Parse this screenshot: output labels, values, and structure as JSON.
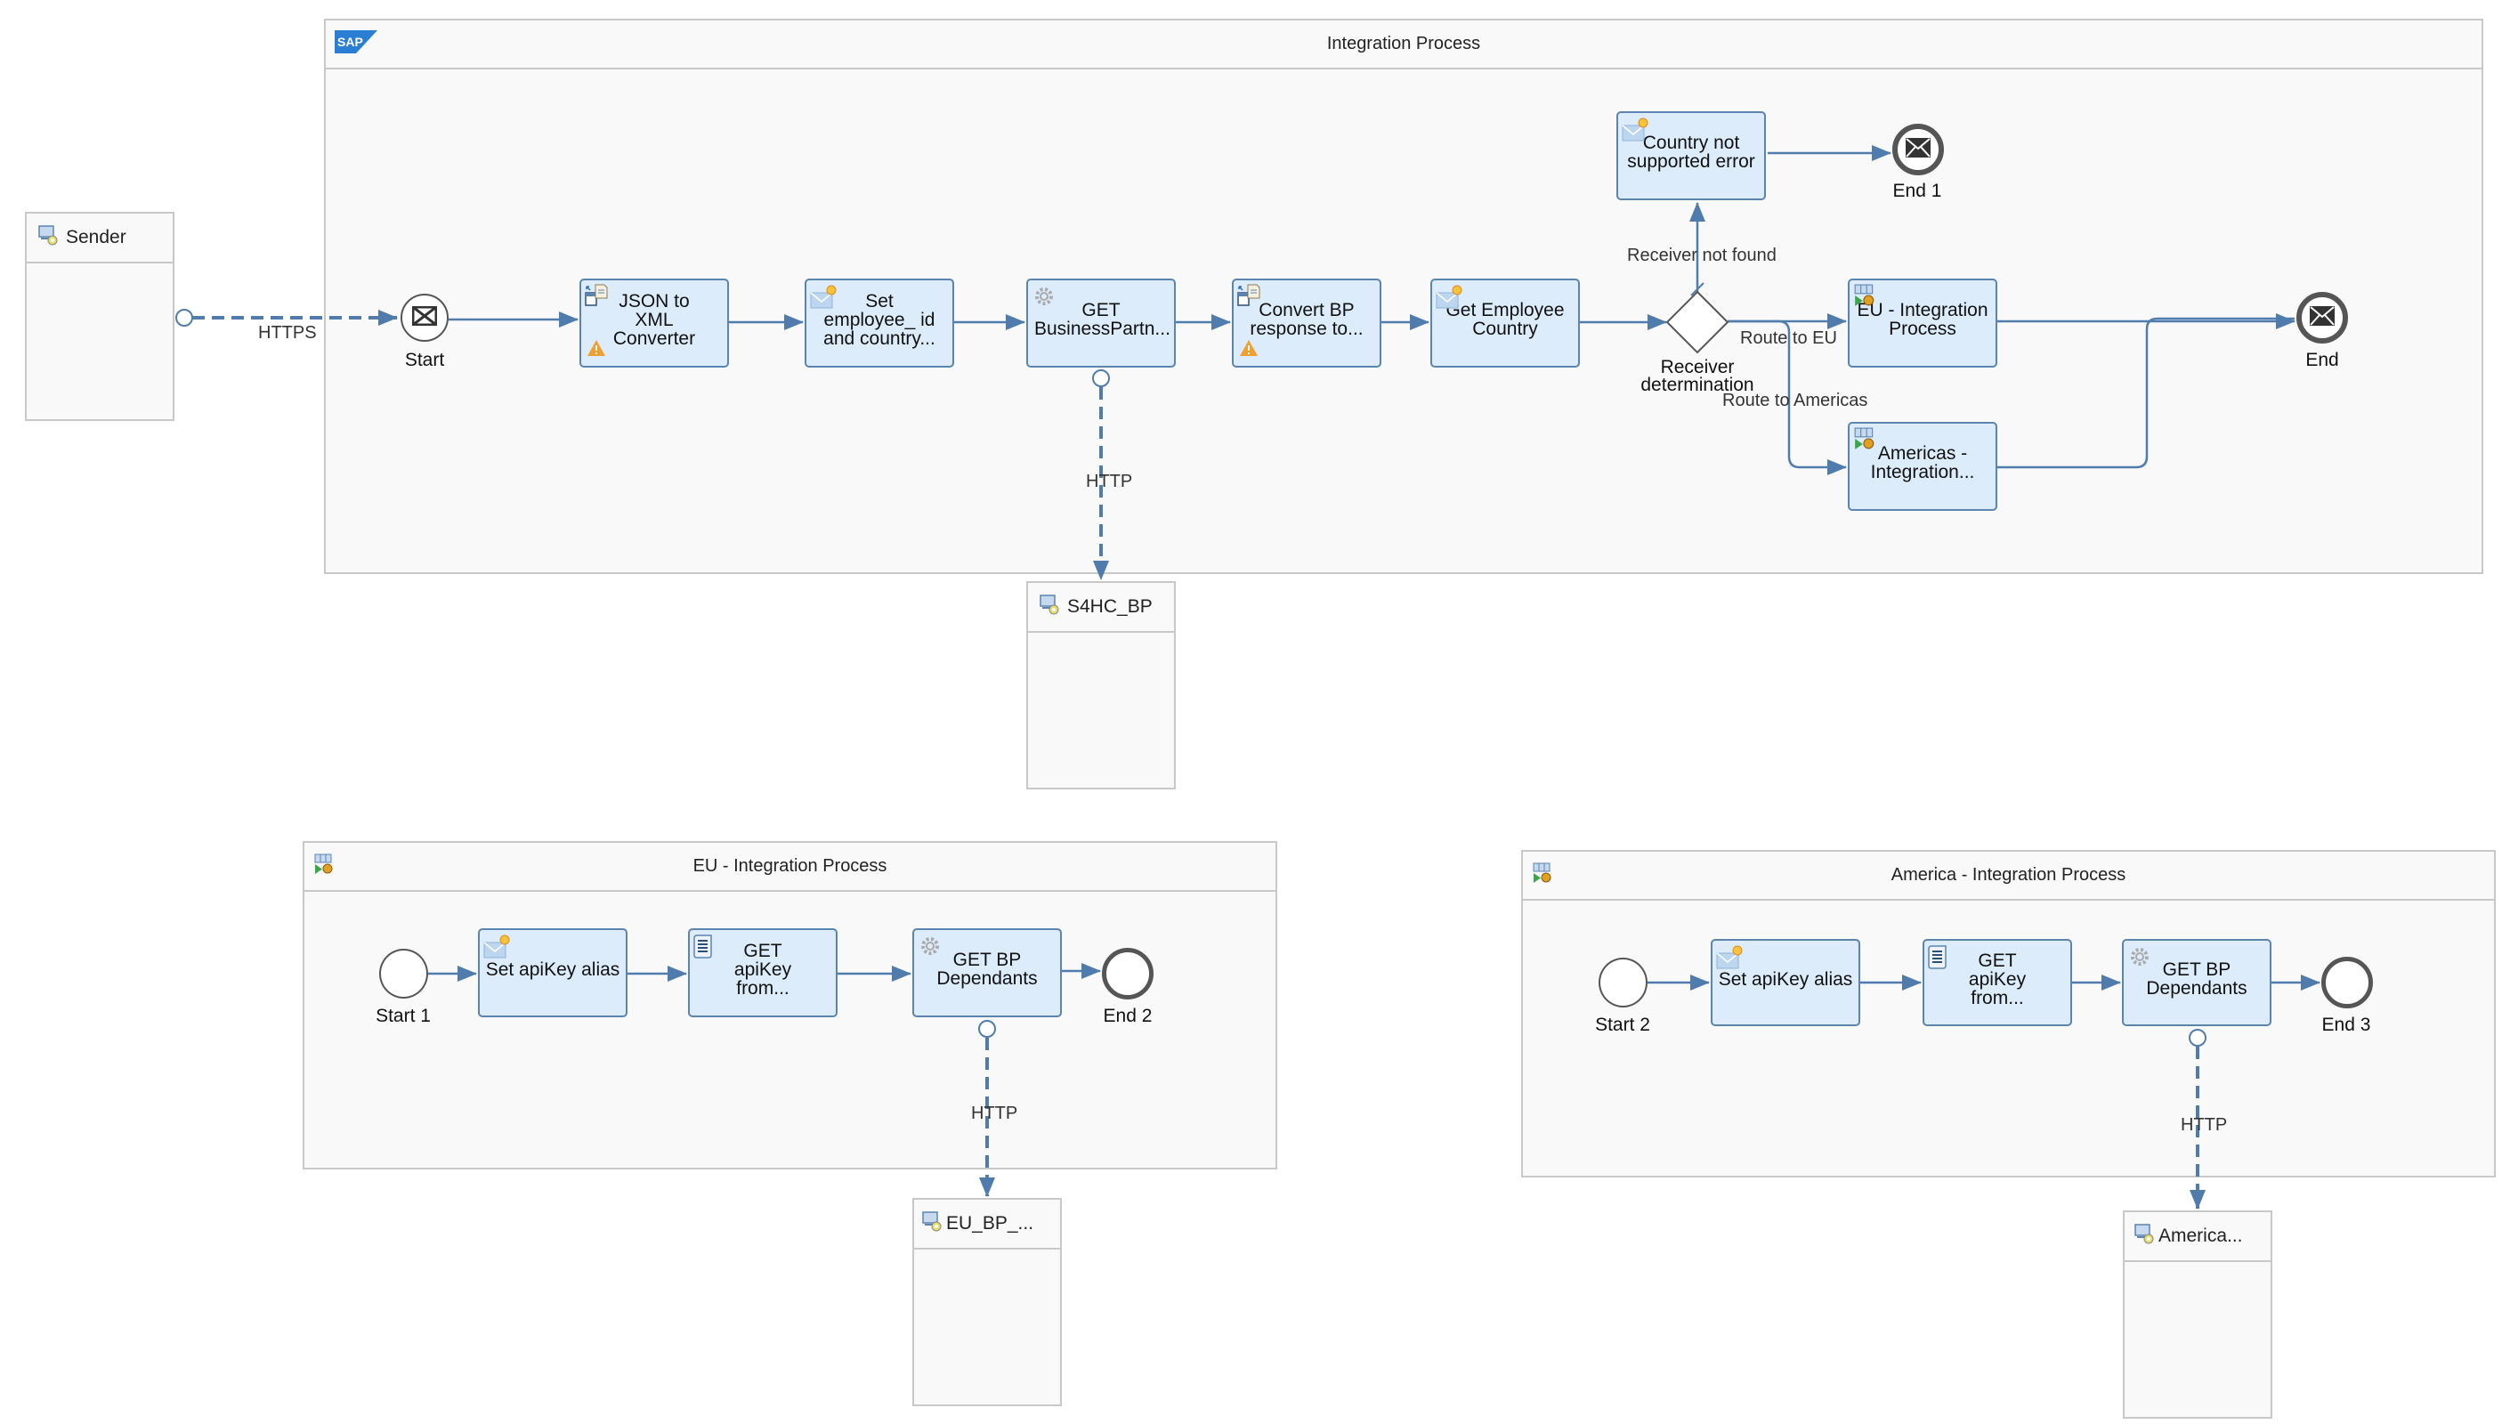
{
  "main_pool": {
    "title": "Integration Process",
    "logo": "sap-logo"
  },
  "participants": {
    "sender": "Sender",
    "s4hc": "S4HC_BP",
    "eu_receiver": "EU_BP_...",
    "america_receiver": "America..."
  },
  "main_flow": {
    "start": "Start",
    "tasks": {
      "json_to_xml": {
        "label": "JSON to XML Converter",
        "icon": "converter-icon",
        "warning": true
      },
      "set_employee": {
        "label": "Set employee_ id and country...",
        "icon": "content-modifier-icon",
        "warning": false
      },
      "get_bp": {
        "label": "GET BusinessPartn...",
        "icon": "service-task-gear-icon",
        "warning": false
      },
      "convert_bp": {
        "label": "Convert BP response to...",
        "icon": "converter-icon",
        "warning": true
      },
      "get_country": {
        "label": "Get Employee Country",
        "icon": "content-modifier-icon",
        "warning": false
      },
      "country_error": {
        "label": "Country not supported error",
        "icon": "content-modifier-icon",
        "warning": false
      },
      "eu_call": {
        "label": "EU - Integration Process",
        "icon": "process-call-icon",
        "warning": false
      },
      "americas_call": {
        "label": "Americas - Integration...",
        "icon": "process-call-icon",
        "warning": false
      }
    },
    "gateway": "Receiver determination",
    "end": "End",
    "end1": "End 1",
    "edges": {
      "sender_adapter": "HTTPS",
      "s4hc_adapter": "HTTP",
      "receiver_not_found": "Receiver not found",
      "route_eu": "Route to EU",
      "route_americas": "Route to Americas"
    }
  },
  "eu_pool": {
    "title": "EU - Integration Process",
    "start": "Start 1",
    "end": "End 2",
    "tasks": [
      "Set apiKey alias",
      "GET apiKey from...",
      "GET BP Dependants"
    ],
    "adapter": "HTTP"
  },
  "america_pool": {
    "title": "America - Integration Process",
    "start": "Start 2",
    "end": "End 3",
    "tasks": [
      "Set apiKey alias",
      "GET apiKey from...",
      "GET BP Dependants"
    ],
    "adapter": "HTTP"
  },
  "colors": {
    "task_fill": "#dcecfb",
    "task_border": "#5b84b1",
    "edge": "#4f7cac",
    "pool_fill": "#f9f9f9",
    "pool_border": "#c8c8c8",
    "warning": "#f0a030"
  }
}
